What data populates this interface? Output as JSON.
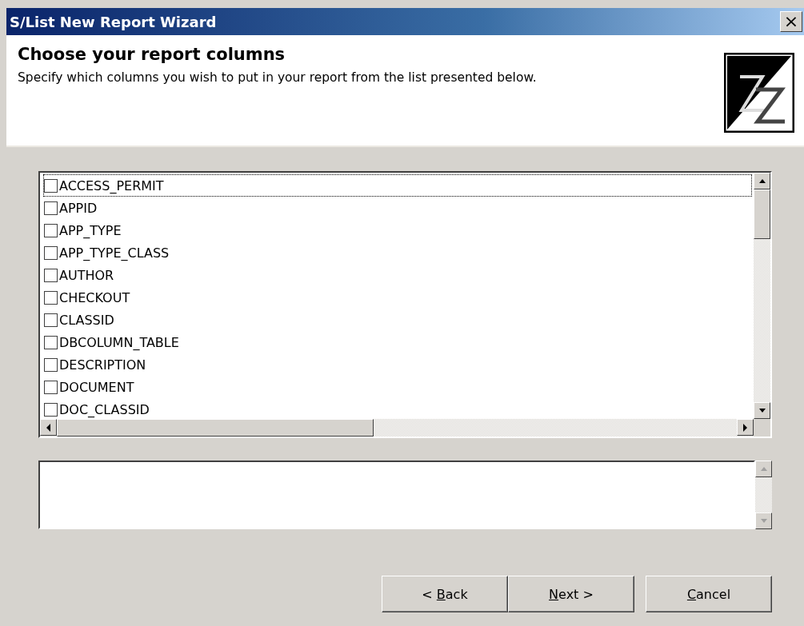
{
  "window": {
    "title": "S/List New Report Wizard",
    "close": "×"
  },
  "header": {
    "title": "Choose your report columns",
    "subtitle": "Specify which columns you wish to put in your report from the list presented below."
  },
  "columns": [
    {
      "label": "ACCESS_PERMIT",
      "checked": false,
      "focused": true
    },
    {
      "label": "APPID",
      "checked": false,
      "focused": false
    },
    {
      "label": "APP_TYPE",
      "checked": false,
      "focused": false
    },
    {
      "label": "APP_TYPE_CLASS",
      "checked": false,
      "focused": false
    },
    {
      "label": "AUTHOR",
      "checked": false,
      "focused": false
    },
    {
      "label": "CHECKOUT",
      "checked": false,
      "focused": false
    },
    {
      "label": "CLASSID",
      "checked": false,
      "focused": false
    },
    {
      "label": "DBCOLUMN_TABLE",
      "checked": false,
      "focused": false
    },
    {
      "label": "DESCRIPTION",
      "checked": false,
      "focused": false
    },
    {
      "label": "DOCUMENT",
      "checked": false,
      "focused": false
    },
    {
      "label": "DOC_CLASSID",
      "checked": false,
      "focused": false
    }
  ],
  "buttons": [
    {
      "parts": [
        {
          "text": "< "
        },
        {
          "text": "B",
          "underline": true
        },
        {
          "text": "ack"
        }
      ]
    },
    {
      "parts": [
        {
          "text": "N",
          "underline": true
        },
        {
          "text": "ext >"
        }
      ]
    },
    {
      "parts": [
        {
          "text": "C",
          "underline": true
        },
        {
          "text": "ancel"
        }
      ]
    }
  ]
}
